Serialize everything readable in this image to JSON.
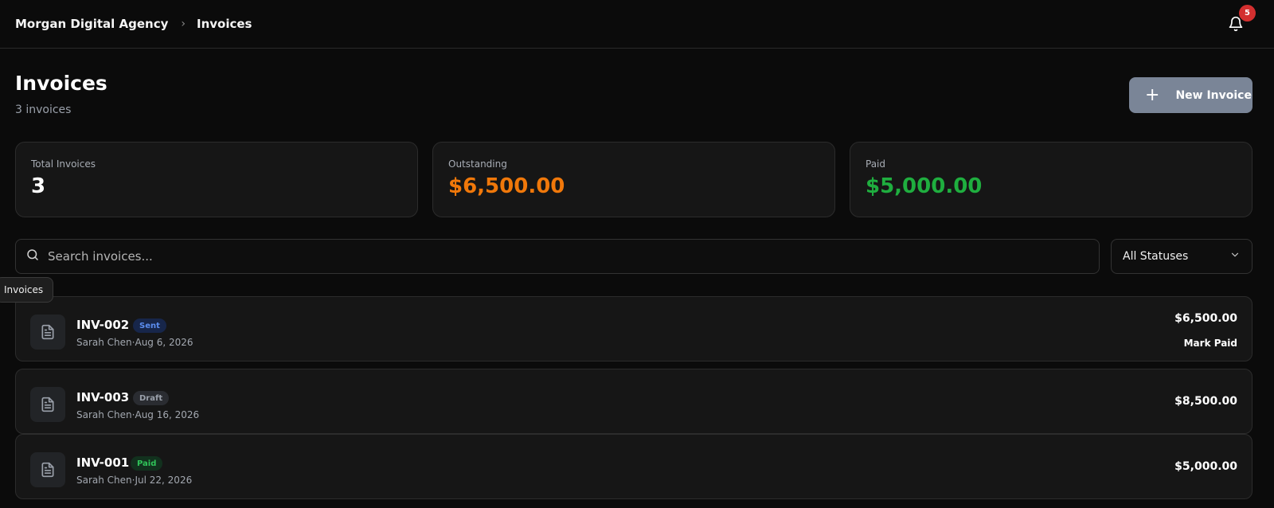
{
  "breadcrumb": {
    "org": "Morgan Digital Agency",
    "current": "Invoices"
  },
  "notifications": {
    "count": "5"
  },
  "header": {
    "title": "Invoices",
    "subtitle": "3 invoices",
    "new_button": "New Invoice"
  },
  "stats": [
    {
      "label": "Total Invoices",
      "value": "3",
      "color": "#ffffff"
    },
    {
      "label": "Outstanding",
      "value": "$6,500.00",
      "color": "#f0780a"
    },
    {
      "label": "Paid",
      "value": "$5,000.00",
      "color": "#1fae3f"
    }
  ],
  "search": {
    "placeholder": "Search invoices..."
  },
  "status_filter": {
    "selected": "All Statuses"
  },
  "tooltip": "Invoices",
  "invoices": [
    {
      "id": "INV-002",
      "status": "Sent",
      "client": "Sarah Chen",
      "date": "Aug 6, 2026",
      "amount": "$6,500.00",
      "action": "Mark Paid"
    },
    {
      "id": "INV-003",
      "status": "Draft",
      "client": "Sarah Chen",
      "date": "Aug 16, 2026",
      "amount": "$8,500.00"
    },
    {
      "id": "INV-001",
      "status": "Paid",
      "client": "Sarah Chen",
      "date": "Jul 22, 2026",
      "amount": "$5,000.00"
    }
  ],
  "meta_separator": "·",
  "icons": {
    "bell": "bell-icon",
    "search": "search-icon",
    "chevron": "chevron-down-icon",
    "plus": "plus-icon",
    "document": "document-icon",
    "breadcrumb_separator": "chevron-right-icon"
  }
}
